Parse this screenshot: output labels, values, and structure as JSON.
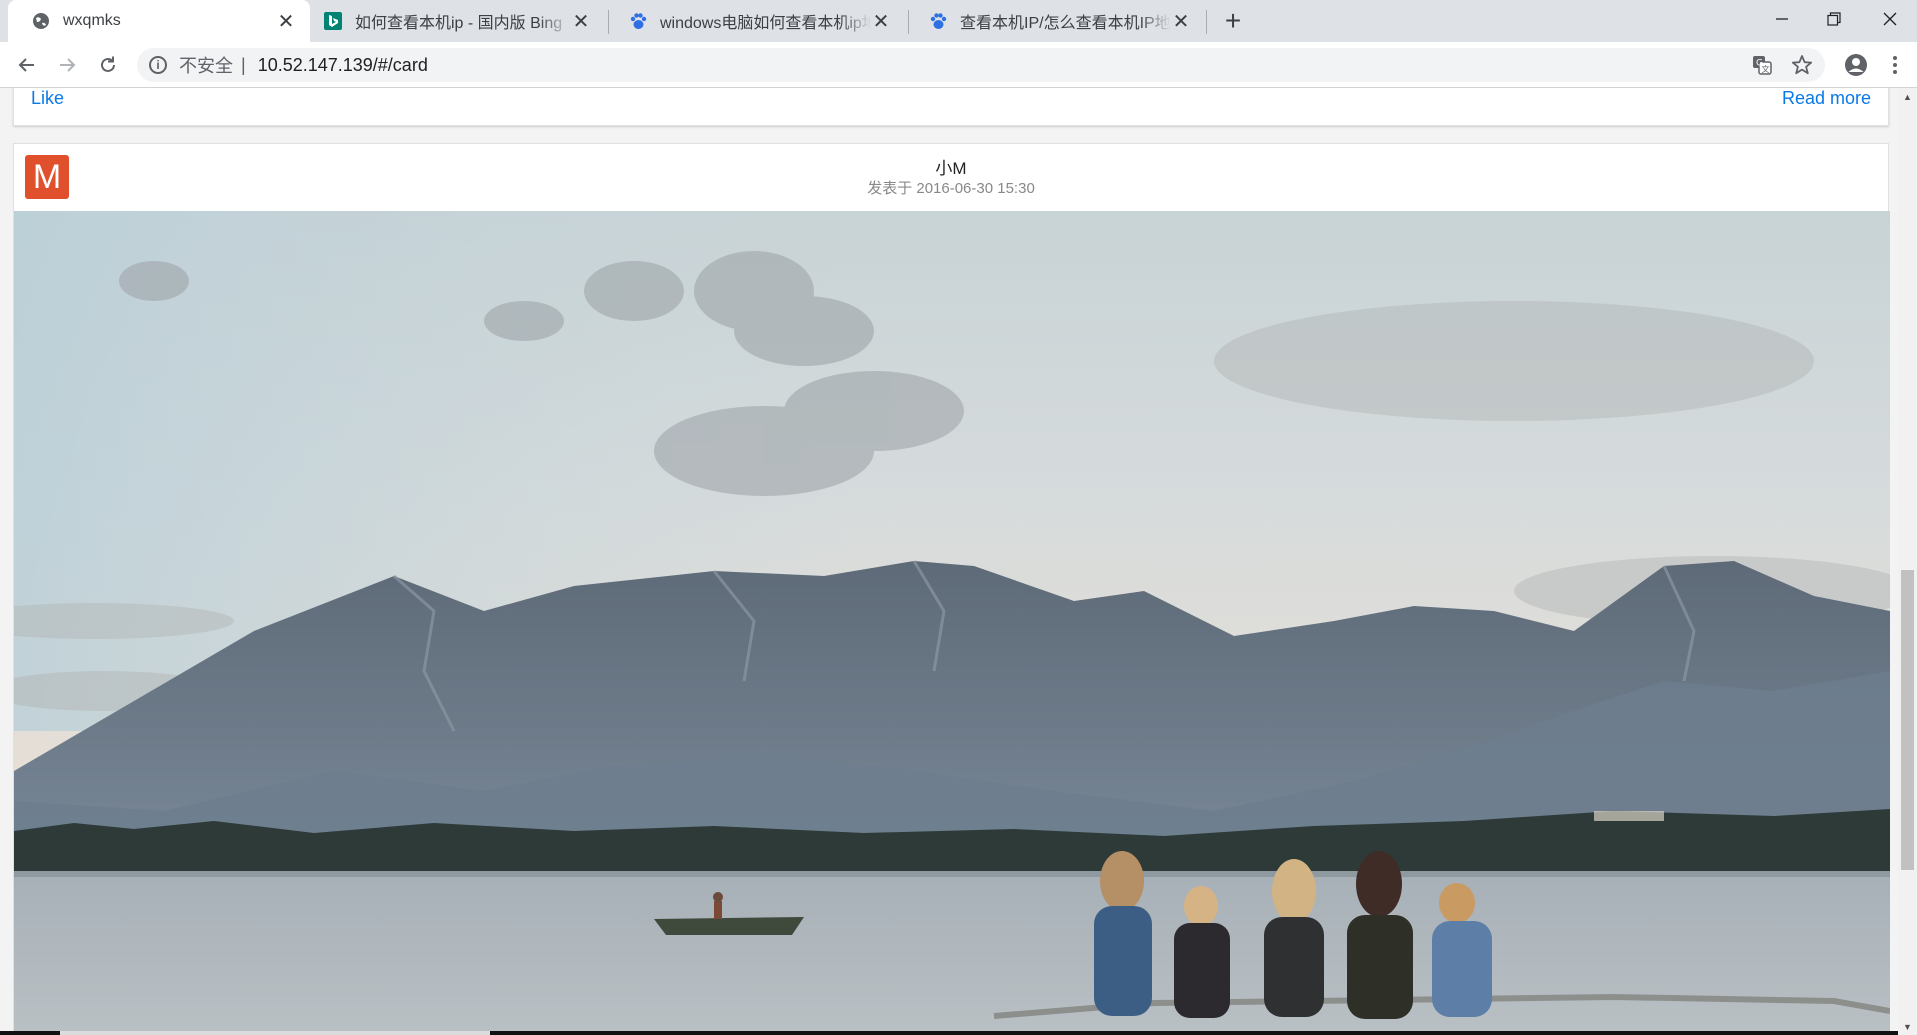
{
  "browser": {
    "tabs": [
      {
        "title": "wxqmks",
        "icon": "globe-icon",
        "active": true
      },
      {
        "title": "如何查看本机ip - 国内版 Bing",
        "icon": "bing-icon",
        "active": false
      },
      {
        "title": "windows电脑如何查看本机ip地址",
        "icon": "baidu-paw-icon",
        "active": false
      },
      {
        "title": "查看本机IP/怎么查看本机IP地址",
        "icon": "baidu-paw-icon",
        "active": false
      }
    ],
    "address": {
      "security_label": "不安全",
      "separator": "|",
      "url": "10.52.147.139/#/card"
    }
  },
  "page": {
    "prev_card": {
      "like_label": "Like",
      "read_more_label": "Read more"
    },
    "card": {
      "avatar_letter": "M",
      "avatar_color": "#e0502d",
      "author": "小M",
      "posted": "发表于 2016-06-30 15:30",
      "image_description_icon": "landscape-photo"
    }
  },
  "colors": {
    "link": "#0a79e8",
    "tabstrip": "#dee1e6"
  }
}
